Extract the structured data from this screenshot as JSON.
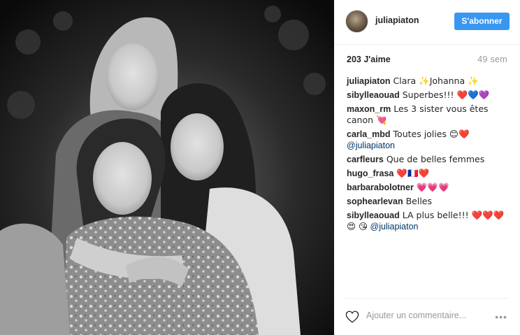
{
  "photo": {
    "alt": "Photo noir et blanc de trois femmes"
  },
  "header": {
    "username": "juliapiaton",
    "follow_label": "S'abonner"
  },
  "meta": {
    "likes": "203 J'aime",
    "age": "49 sem"
  },
  "comments": [
    {
      "user": "juliapiaton",
      "text": "Clara ✨Johanna ✨"
    },
    {
      "user": "sibylleaouad",
      "text": "Superbes!!! ❤️💙💜"
    },
    {
      "user": "maxon_rm",
      "text": "Les 3 sister vous êtes canon 💘"
    },
    {
      "user": "carla_mbd",
      "text": "Toutes jolies 😊❤️",
      "mention": "@juliapiaton"
    },
    {
      "user": "carfleurs",
      "text": "Que de belles femmes"
    },
    {
      "user": "hugo_frasa",
      "text": "❤️🇫🇷❤️"
    },
    {
      "user": "barbarabolotner",
      "text": "💗💗💗"
    },
    {
      "user": "sophearlevan",
      "text": "Belles"
    },
    {
      "user": "sibylleaouad",
      "text": "LA plus belle!!! ❤️❤️❤️😍 😘",
      "mention": "@juliapiaton"
    }
  ],
  "footer": {
    "comment_placeholder": "Ajouter un commentaire...",
    "more_label": "•••"
  },
  "colors": {
    "accent": "#3897f0",
    "mention": "#003569",
    "muted": "#999999"
  },
  "icons": {
    "like": "heart-icon",
    "more": "more-options-icon"
  }
}
